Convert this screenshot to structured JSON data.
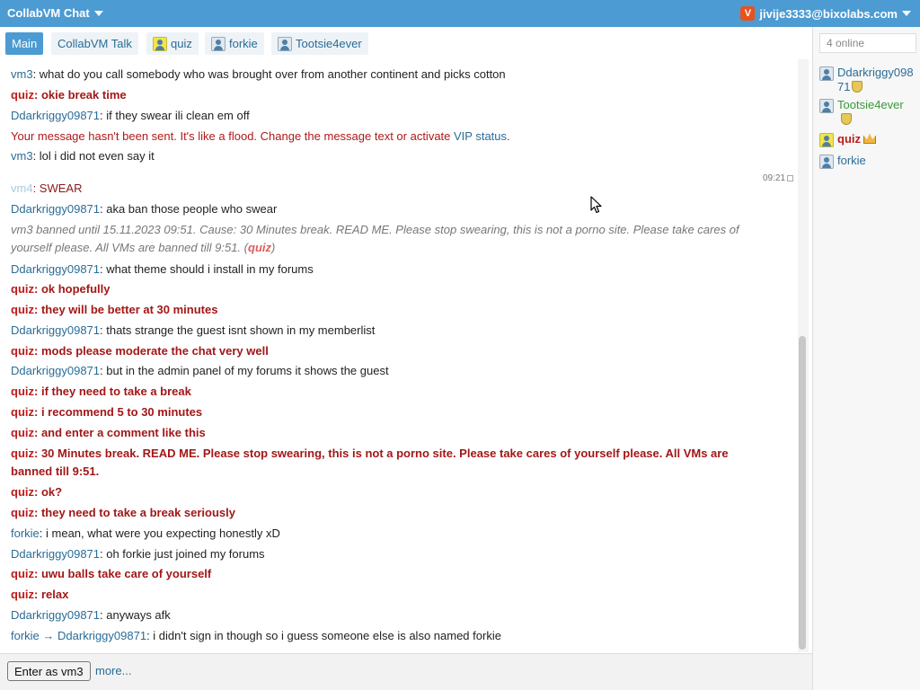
{
  "topbar": {
    "title": "CollabVM Chat",
    "account": "jivije3333@bixolabs.com",
    "logo_letter": "V"
  },
  "tabs": [
    {
      "label": "Main",
      "active": true
    },
    {
      "label": "CollabVM Talk"
    },
    {
      "label": "quiz",
      "icon": "user-icon-yellow"
    },
    {
      "label": "forkie",
      "icon": "user-icon"
    },
    {
      "label": "Tootsie4ever",
      "icon": "user-icon"
    }
  ],
  "messages": {
    "m1": {
      "nick": "vm3",
      "text": ": what do you call somebody who was brought over from another continent and picks cotton"
    },
    "m2": {
      "nick": "quiz",
      "text": "okie break time"
    },
    "m3": {
      "nick": "Ddarkriggy09871",
      "text": ": if they swear ili clean em off"
    },
    "m4": {
      "text": "Your message hasn't been sent. It's like a flood. Change the message text or activate ",
      "link": "VIP status",
      "end": "."
    },
    "m5": {
      "nick": "vm3",
      "text": ": lol i did not even say it"
    },
    "timestamp": "09:21",
    "m6": {
      "nick": "vm4",
      "text": "SWEAR"
    },
    "m7": {
      "nick": "Ddarkriggy09871",
      "text": ": aka ban those people who swear"
    },
    "m8": {
      "line1": "vm3 banned until 15.11.2023 09:51. Cause: 30 Minutes break. READ ME. Please stop swearing, this is not a porno site. Please take cares of",
      "line2": "yourself please. All VMs are banned till 9:51. (",
      "by": "quiz",
      "close": ")"
    },
    "m9": {
      "nick": "Ddarkriggy09871",
      "text": ": what theme should i install in my forums"
    },
    "m10": {
      "nick": "quiz",
      "text": "ok hopefully"
    },
    "m11": {
      "nick": "quiz",
      "text": "they will be better at 30 minutes"
    },
    "m12": {
      "nick": "Ddarkriggy09871",
      "text": ": thats strange the guest isnt shown in my memberlist"
    },
    "m13": {
      "nick": "quiz",
      "text": "mods please moderate the chat very well"
    },
    "m14": {
      "nick": "Ddarkriggy09871",
      "text": ": but in the admin panel of my forums it shows the guest"
    },
    "m15": {
      "nick": "quiz",
      "text": "if they need to take a break"
    },
    "m16": {
      "nick": "quiz",
      "text": "i recommend 5 to 30 minutes"
    },
    "m17": {
      "nick": "quiz",
      "text": "and enter a comment like this"
    },
    "m18": {
      "nick": "quiz",
      "line1": "30 Minutes break. READ ME. Please stop swearing, this is not a porno site. Please take cares of yourself please. All VMs are",
      "line2": "banned till 9:51."
    },
    "m19": {
      "nick": "quiz",
      "text": "ok?"
    },
    "m20": {
      "nick": "quiz",
      "text": "they need to take a break seriously"
    },
    "m21": {
      "nick": "forkie",
      "text": ": i mean, what were you expecting honestly xD"
    },
    "m22": {
      "nick": "Ddarkriggy09871",
      "text": ": oh forkie just joined my forums"
    },
    "m23": {
      "nick": "quiz",
      "text": "uwu balls take care of yourself"
    },
    "m24": {
      "nick": "quiz",
      "text": "relax"
    },
    "m25": {
      "nick": "Ddarkriggy09871",
      "text": ": anyways afk"
    },
    "m26": {
      "nick": "forkie",
      "arrow": "→",
      "to": "Ddarkriggy09871",
      "text": ": i didn't sign in though so i guess someone else is also named forkie"
    }
  },
  "sep": ": ",
  "bottom": {
    "enter_button": "Enter as vm3",
    "more": "more..."
  },
  "sidebar": {
    "online": "4 online",
    "users": [
      {
        "name": "Ddarkriggy09871",
        "badge": "shield"
      },
      {
        "name": "Tootsie4ever",
        "badge": "shield"
      },
      {
        "name": "quiz",
        "badge": "crown"
      },
      {
        "name": "forkie"
      }
    ]
  },
  "colors": {
    "topbar": "#4c9bd2",
    "nick": "#2a6c96",
    "mod_red": "#bd1a1a"
  }
}
